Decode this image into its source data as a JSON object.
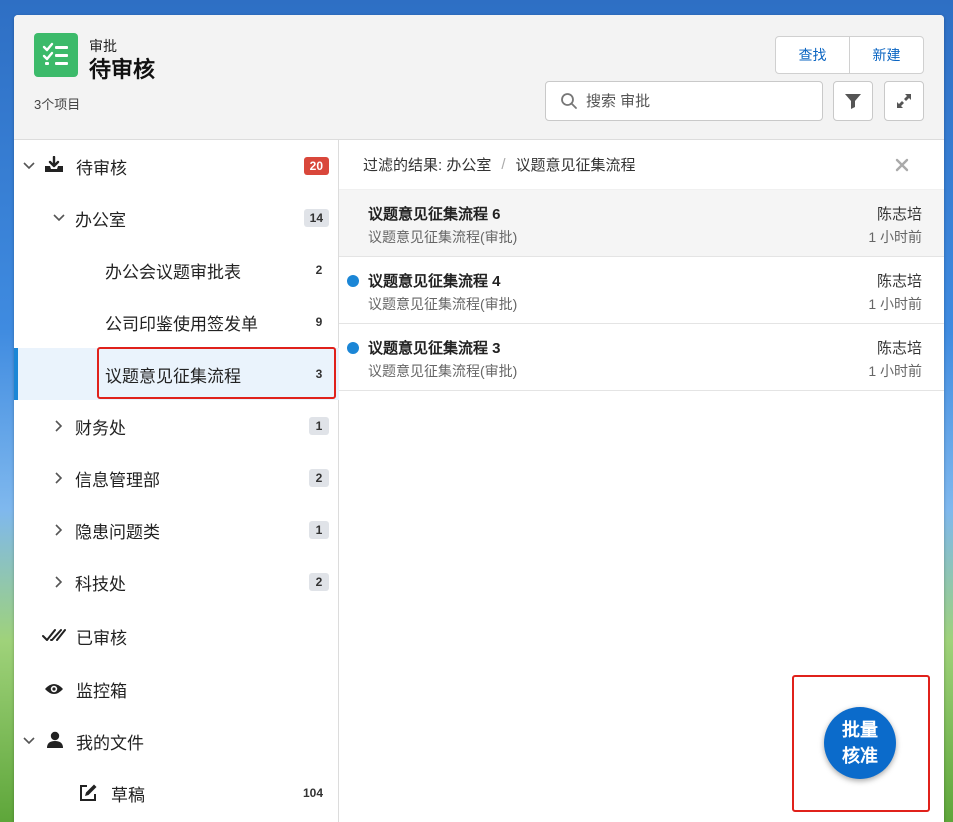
{
  "header": {
    "subtitle": "审批",
    "title": "待审核",
    "count": "3个项目",
    "find_label": "查找",
    "new_label": "新建",
    "search_placeholder": "搜索 审批"
  },
  "sidebar": {
    "pending": {
      "label": "待审核",
      "badge": "20"
    },
    "office": {
      "label": "办公室",
      "badge": "14"
    },
    "office_children": [
      {
        "label": "办公会议题审批表",
        "badge": "2"
      },
      {
        "label": "公司印鉴使用签发单",
        "badge": "9"
      },
      {
        "label": "议题意见征集流程",
        "badge": "3"
      }
    ],
    "depts": [
      {
        "label": "财务处",
        "badge": "1"
      },
      {
        "label": "信息管理部",
        "badge": "2"
      },
      {
        "label": "隐患问题类",
        "badge": "1"
      },
      {
        "label": "科技处",
        "badge": "2"
      }
    ],
    "reviewed": {
      "label": "已审核"
    },
    "monitor": {
      "label": "监控箱"
    },
    "myfiles": {
      "label": "我的文件"
    },
    "drafts": {
      "label": "草稿",
      "badge": "104"
    }
  },
  "filter": {
    "prefix": "过滤的结果: 办公室",
    "separator": "/",
    "current": "议题意见征集流程"
  },
  "records": [
    {
      "title": "议题意见征集流程 6",
      "subtitle": "议题意见征集流程(审批)",
      "user": "陈志培",
      "time": "1 小时前",
      "unread": false
    },
    {
      "title": "议题意见征集流程 4",
      "subtitle": "议题意见征集流程(审批)",
      "user": "陈志培",
      "time": "1 小时前",
      "unread": true
    },
    {
      "title": "议题意见征集流程 3",
      "subtitle": "议题意见征集流程(审批)",
      "user": "陈志培",
      "time": "1 小时前",
      "unread": true
    }
  ],
  "fab": {
    "line1": "批量",
    "line2": "核准"
  },
  "colors": {
    "accent": "#1b86d6",
    "app_icon": "#3cba6a",
    "badge_red": "#d9473b",
    "highlight": "#e0211b",
    "fab": "#0b6bcb"
  }
}
